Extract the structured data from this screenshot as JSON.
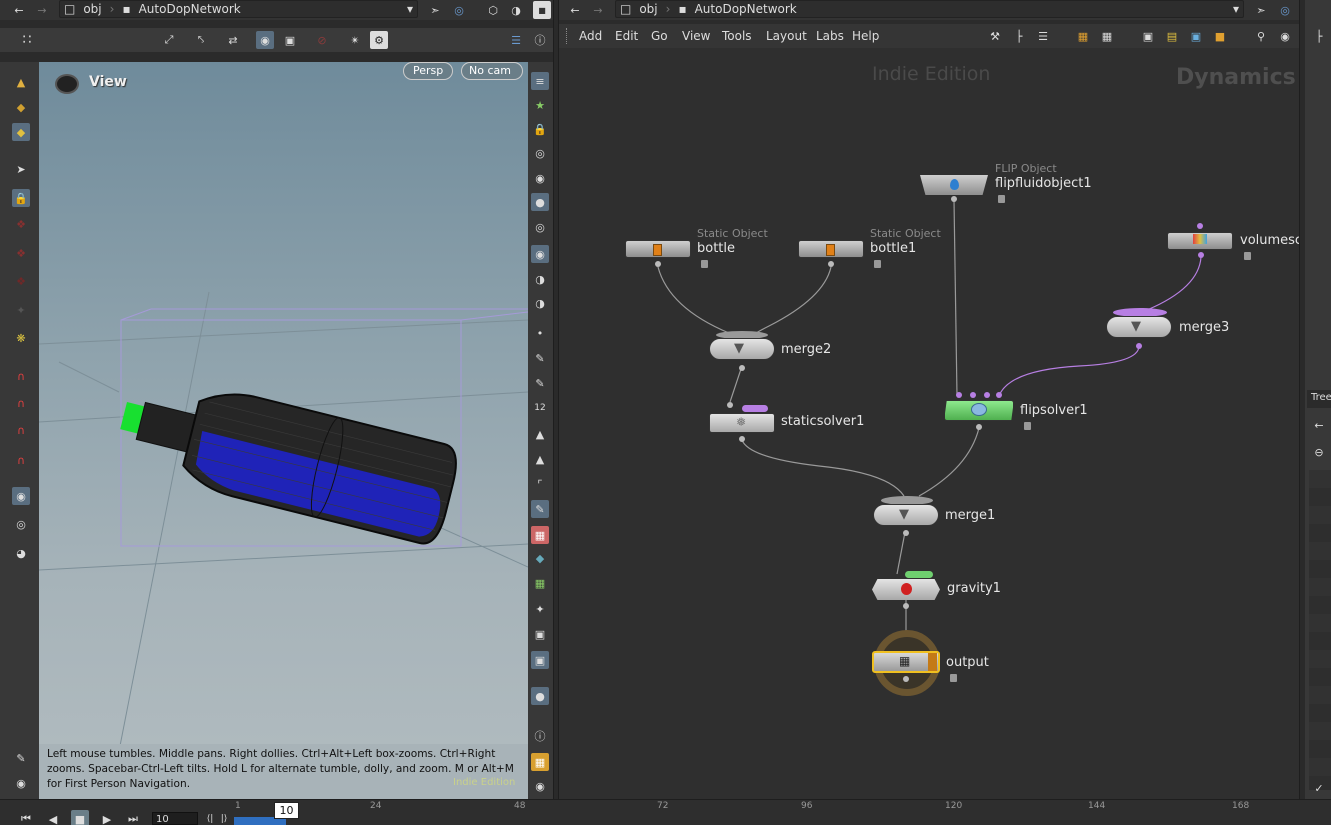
{
  "colors": {
    "accent": "#4d6f8c",
    "flip_green": "#6fcf6f",
    "purple": "#b77fe3",
    "output_orange": "#c47a16"
  },
  "left_pane": {
    "path": {
      "root": "obj",
      "network": "AutoDopNetwork"
    },
    "view_title": "View",
    "persp": "Persp",
    "camera": "No cam",
    "hint": "Left mouse tumbles. Middle pans. Right dollies. Ctrl+Alt+Left box-zooms. Ctrl+Right zooms. Spacebar-Ctrl-Left tilts. Hold L for alternate tumble, dolly, and zoom. M or Alt+M for First Person Navigation.",
    "edition_watermark": "Indie Edition"
  },
  "right_pane": {
    "path": {
      "root": "obj",
      "network": "AutoDopNetwork"
    },
    "menu": [
      "Add",
      "Edit",
      "Go",
      "View",
      "Tools",
      "Layout",
      "Labs",
      "Help"
    ],
    "edition": "Indie Edition",
    "context": "Dynamics",
    "nodes": {
      "bottle": {
        "type": "Static Object",
        "name": "bottle"
      },
      "bottle1": {
        "type": "Static Object",
        "name": "bottle1"
      },
      "flipfluid": {
        "type": "FLIP Object",
        "name": "flipfluidobject1"
      },
      "volume": {
        "name": "volumesc"
      },
      "merge2": {
        "name": "merge2"
      },
      "merge3": {
        "name": "merge3"
      },
      "staticsolver": {
        "name": "staticsolver1"
      },
      "flipsolver": {
        "name": "flipsolver1"
      },
      "merge1": {
        "name": "merge1"
      },
      "gravity": {
        "name": "gravity1"
      },
      "output": {
        "name": "output"
      }
    }
  },
  "side_panel": {
    "tab": "Tree"
  },
  "timeline": {
    "current_frame": "10",
    "frame_field": "10",
    "ticks": [
      "1",
      "24",
      "48",
      "72",
      "96",
      "120",
      "144",
      "168"
    ]
  }
}
